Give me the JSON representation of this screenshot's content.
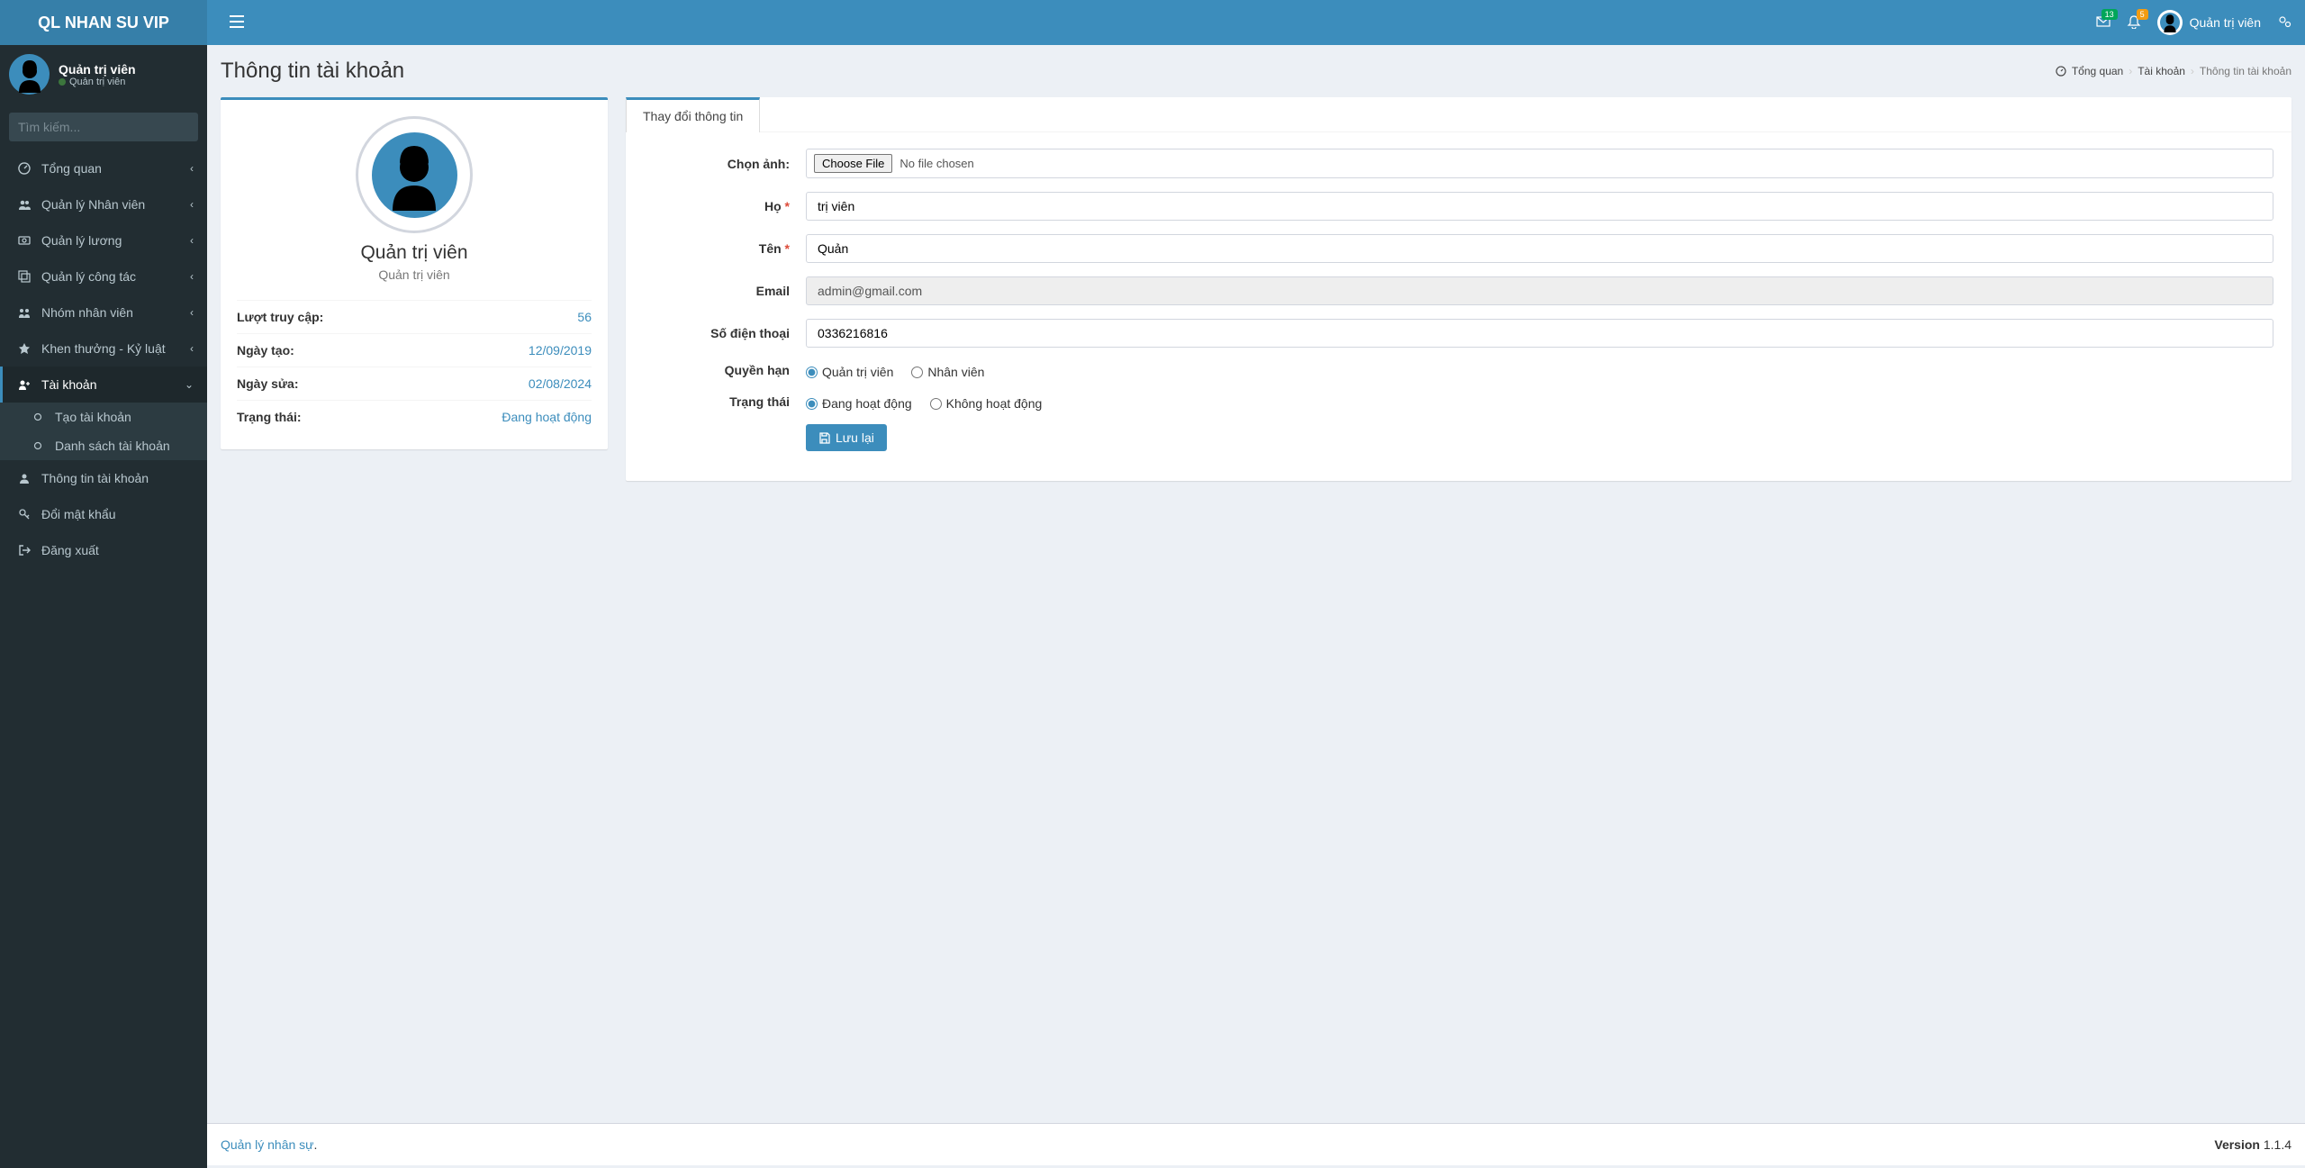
{
  "brand": "QL NHAN SU VIP",
  "header": {
    "messages_badge": "13",
    "notifications_badge": "5",
    "user_name": "Quản trị viên"
  },
  "user_panel": {
    "name": "Quản trị viên",
    "status": "Quản trị viên"
  },
  "search": {
    "placeholder": "Tìm kiếm..."
  },
  "sidebar": {
    "items": [
      {
        "label": "Tổng quan"
      },
      {
        "label": "Quản lý Nhân viên"
      },
      {
        "label": "Quản lý lương"
      },
      {
        "label": "Quản lý công tác"
      },
      {
        "label": "Nhóm nhân viên"
      },
      {
        "label": "Khen thưởng - Kỷ luật"
      },
      {
        "label": "Tài khoản"
      },
      {
        "label": "Thông tin tài khoản"
      },
      {
        "label": "Đổi mật khẩu"
      },
      {
        "label": "Đăng xuất"
      }
    ],
    "submenu_account": [
      {
        "label": "Tạo tài khoản"
      },
      {
        "label": "Danh sách tài khoản"
      }
    ]
  },
  "page": {
    "title": "Thông tin tài khoản",
    "breadcrumb": {
      "home": "Tổng quan",
      "mid": "Tài khoản",
      "current": "Thông tin tài khoản"
    }
  },
  "profile": {
    "name": "Quản trị viên",
    "role": "Quản trị viên",
    "rows": [
      {
        "label": "Lượt truy cập:",
        "value": "56"
      },
      {
        "label": "Ngày tạo:",
        "value": "12/09/2019"
      },
      {
        "label": "Ngày sửa:",
        "value": "02/08/2024"
      },
      {
        "label": "Trạng thái:",
        "value": "Đang hoạt động"
      }
    ]
  },
  "form": {
    "tab": "Thay đổi thông tin",
    "choose_image_label": "Chọn ảnh:",
    "choose_file_btn": "Choose File",
    "no_file": "No file chosen",
    "lastname_label": "Họ",
    "lastname_value": "trị viên",
    "firstname_label": "Tên",
    "firstname_value": "Quản",
    "email_label": "Email",
    "email_value": "admin@gmail.com",
    "phone_label": "Số điện thoại",
    "phone_value": "0336216816",
    "role_label": "Quyền hạn",
    "role_admin": "Quản trị viên",
    "role_staff": "Nhân viên",
    "status_label": "Trạng thái",
    "status_active": "Đang hoạt động",
    "status_inactive": "Không hoạt động",
    "save_btn": "Lưu lại"
  },
  "footer": {
    "left_link": "Quản lý nhân sự",
    "left_suffix": ".",
    "version_label": "Version",
    "version": "1.1.4"
  }
}
